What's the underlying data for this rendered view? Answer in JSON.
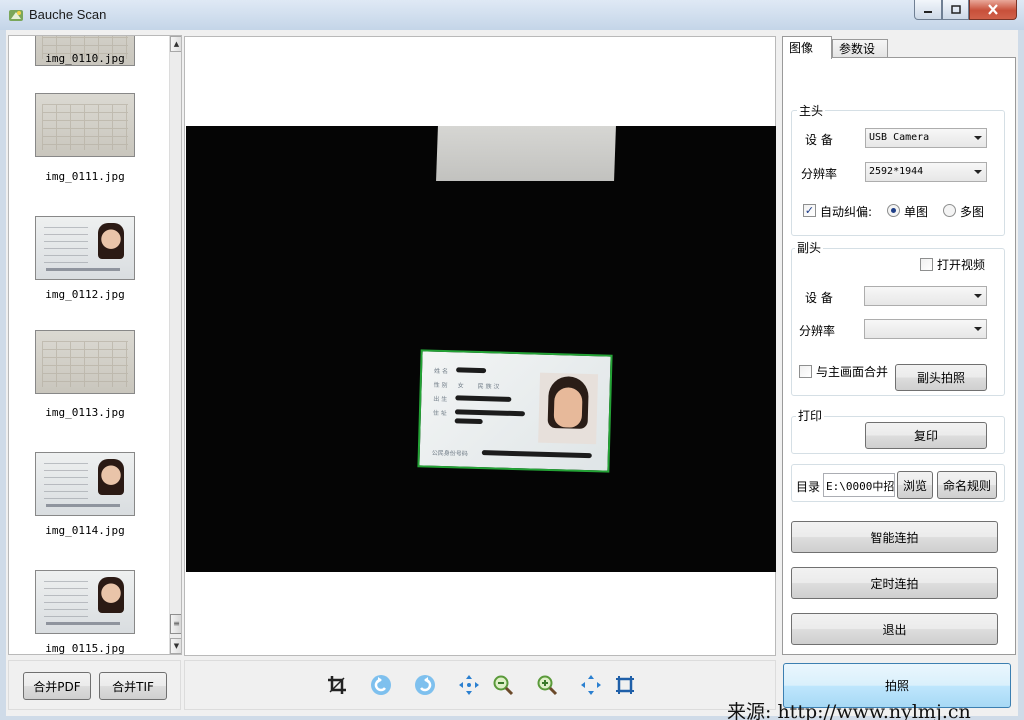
{
  "window": {
    "title": "Bauche Scan"
  },
  "thumbnails": [
    {
      "label": "img_0110.jpg"
    },
    {
      "label": "img_0111.jpg"
    },
    {
      "label": "img_0112.jpg"
    },
    {
      "label": "img_0113.jpg"
    },
    {
      "label": "img_0114.jpg"
    },
    {
      "label": "img_0115.jpg"
    }
  ],
  "tabs": {
    "image": "图像",
    "params": "参数设置"
  },
  "main_head": {
    "title": "主头",
    "device_label": "设 备",
    "device_value": "USB Camera",
    "resolution_label": "分辨率",
    "resolution_value": "2592*1944",
    "auto_deskew_label": "自动纠偏:",
    "auto_deskew_checked": true,
    "single_label": "单图",
    "multi_label": "多图",
    "mode_selected": "single"
  },
  "sub_head": {
    "title": "副头",
    "open_video_label": "打开视频",
    "device_label": "设 备",
    "device_value": "",
    "resolution_label": "分辨率",
    "resolution_value": "",
    "merge_label": "与主画面合并",
    "capture_button": "副头拍照"
  },
  "print": {
    "title": "打印",
    "copy_button": "复印"
  },
  "directory": {
    "label": "目录",
    "path": "E:\\0000中招",
    "browse_button": "浏览",
    "naming_button": "命名规则"
  },
  "actions": {
    "smart_burst": "智能连拍",
    "timed_burst": "定时连拍",
    "exit": "退出",
    "shoot": "拍照"
  },
  "bottom": {
    "merge_pdf": "合并PDF",
    "merge_tif": "合并TIF"
  },
  "toolbar_icons": [
    "crop-icon",
    "rotate-left-icon",
    "rotate-right-icon",
    "move-icon",
    "zoom-out-icon",
    "zoom-in-icon",
    "fit-icon",
    "fullscreen-icon"
  ],
  "watermark": "来源: http://www.nylmj.cn",
  "colors": {
    "detect_border": "#24a336",
    "icon_blue": "#2a7fd0"
  }
}
